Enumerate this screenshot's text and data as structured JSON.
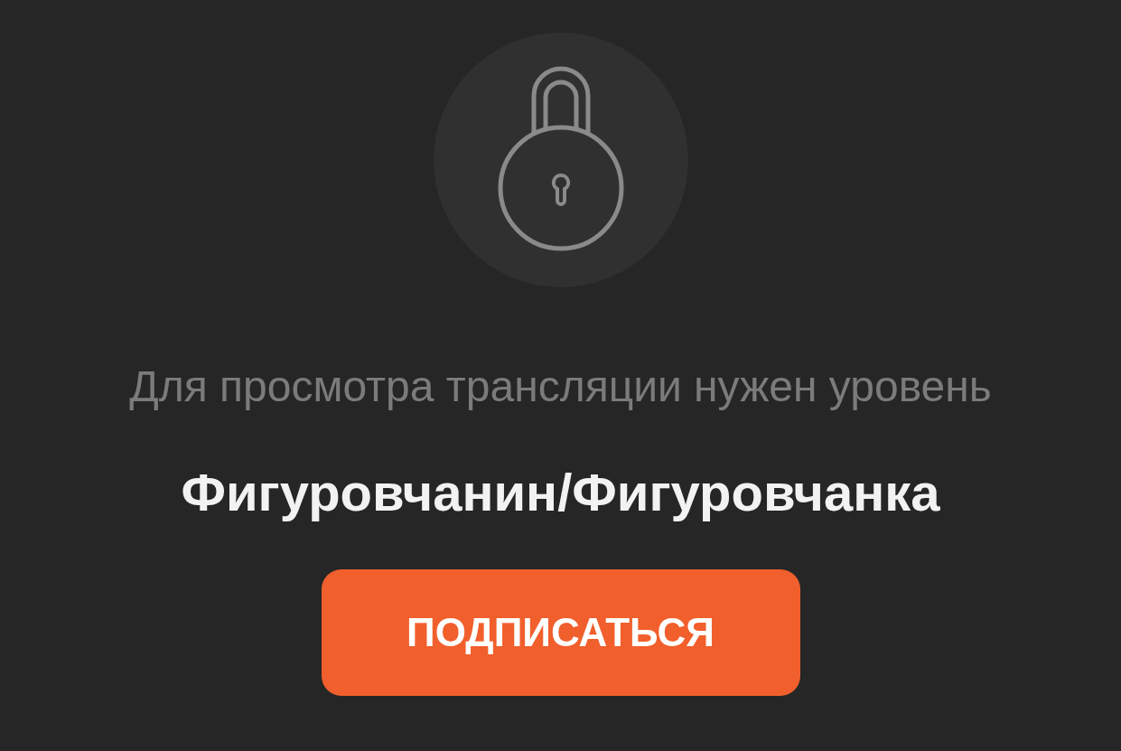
{
  "message": "Для просмотра трансляции нужен уровень",
  "level_name": "Фигуровчанин/Фигуровчанка",
  "button": {
    "label": "ПОДПИСАТЬСЯ"
  }
}
